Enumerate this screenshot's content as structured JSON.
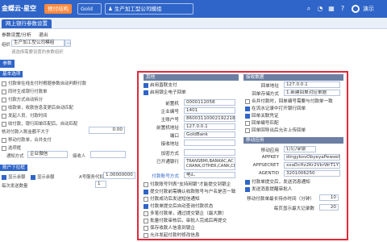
{
  "topbar": {
    "logo": "金蝶云·星空",
    "badge": "预付结构",
    "account": "Gold",
    "org": "生产加工型公司模组",
    "user": "演示"
  },
  "section_tab": "网上银行参数设置",
  "subtabs": [
    "参数设置/分析",
    "退出"
  ],
  "left": {
    "org_label": "组织",
    "org_value": "生产加工型公司模组",
    "org_hint": "请选择需要设置的参数组织",
    "side_button": "参数",
    "items": [
      "基本选项",
      "付款单在线支付时根据参数自动判断付款",
      "同时生成银行付款单",
      "付款方式自动拆分",
      "收款单，收款信息变更后自动匹配",
      "发起人员、付款时间",
      "收付款，银行回单匹配后，自动匹配",
      "核对付款入账金额不大于",
      "移动付款单，合并支付",
      "选项框"
    ],
    "fields": {
      "amount_value": "0.00",
      "mode_label": "通知方式",
      "mode_value": "企业微信",
      "receiver_label": "接收人"
    },
    "lower_head": "账户下拉框",
    "lower_items": [
      "显示余额",
      "显示余额",
      "每次发送数量",
      "A号服务代扣"
    ],
    "rate_value": "1.00000000",
    "count_value": "1"
  },
  "dialog": {
    "left_head": "其他",
    "left_checks": [
      {
        "label": "启用直联支付",
        "on": true
      },
      {
        "label": "启用银企电子回单",
        "on": true
      }
    ],
    "fields": [
      {
        "label": "前置机",
        "value": "0000112058"
      },
      {
        "label": "企业编号",
        "value": "1401"
      },
      {
        "label": "主账户号",
        "value": "86003110002192218"
      },
      {
        "label": "前置机地址",
        "value": "127.0.0.1"
      },
      {
        "label": "端口",
        "value": "GoldBank"
      },
      {
        "label": "接收地址",
        "value": ""
      }
    ],
    "encrypt_label": "加密方式",
    "encrypt_value": "",
    "bank_list_label": "已开通银行",
    "bank_list": [
      "TRANSBMI,BANKAC,AC",
      "CRANK,OTHER,CANK,CI"
    ],
    "special_label": "付款账号方式",
    "special_value": "电汇",
    "options": [
      {
        "label": "付款账号列表\"支持网银\"才能提交到银企",
        "on": false
      },
      {
        "label": "提交付款前需确认收款账号与户名是否一致",
        "on": true
      },
      {
        "label": "付款成功后发送短信通知",
        "on": false
      },
      {
        "label": "付款单提交后自动查询付款状态",
        "on": true
      },
      {
        "label": "多笔付款单，通过提交银企（最大数）",
        "on": false
      },
      {
        "label": "批量付款审核后，审批人完成后再提交",
        "on": false
      },
      {
        "label": "保存收款人信息到银企",
        "on": false
      },
      {
        "label": "允许发起付款时修改信息",
        "on": false
      },
      {
        "label": "允许已审核付款单，重新提交",
        "on": false
      }
    ],
    "right_head1": "接收数据",
    "r_fields": [
      {
        "label": "回单地址",
        "value": "127.0.0.1"
      },
      {
        "label": "回单存储方式",
        "value": "1.新建回单对应单据"
      }
    ],
    "r_checks": [
      {
        "label": "合并付款时，回单编号需要与付款单一致",
        "on": false
      },
      {
        "label": "在流水记录中打开银行回单",
        "on": true
      },
      {
        "label": "回单关联凭证",
        "on": true
      },
      {
        "label": "回单编号匹配",
        "on": false
      },
      {
        "label": "回单回导出后允许上传回单",
        "on": false
      }
    ],
    "right_head2": "移动应用",
    "m_fields": [
      {
        "label": "移动应用",
        "value": "钉钉/掌银"
      },
      {
        "label": "APPKEY",
        "value": "dingykovObyeyaPewxehoqa"
      },
      {
        "label": "APPSECRET",
        "value": "xxaDcHz2Kr2VkrWrT1Y7"
      },
      {
        "label": "AGENTID",
        "value": "3201006250"
      }
    ],
    "m_checks": [
      {
        "label": "付款单提交后，发送消息通知",
        "on": true
      },
      {
        "label": "发送消息提醒审批人",
        "on": true
      }
    ],
    "cycle_label": "移动付款单最长待办时间（分钟）",
    "cycle_value": "10",
    "batch_label": "每页显示最大记录数",
    "batch_value": "20"
  }
}
